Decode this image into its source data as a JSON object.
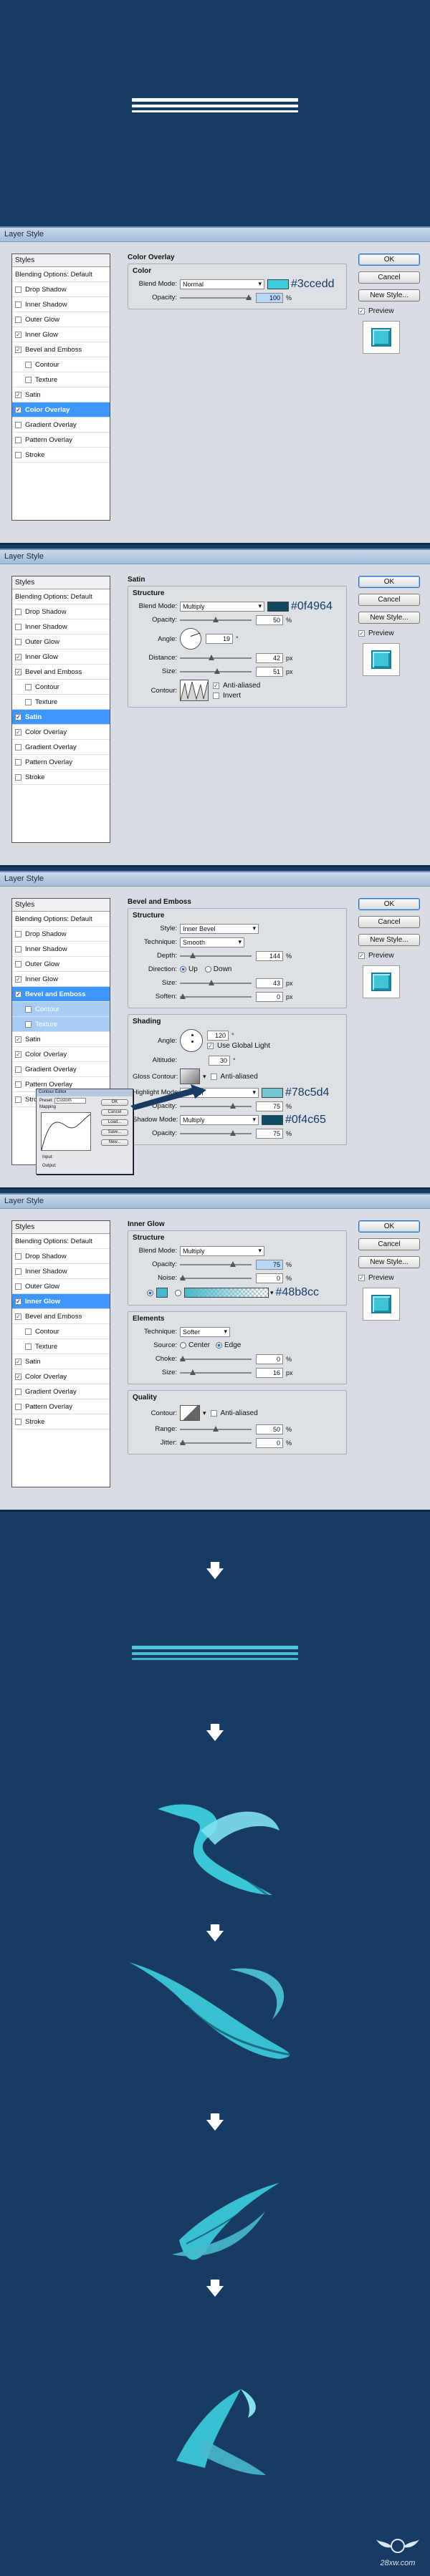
{
  "styles_list": [
    "Styles",
    "Blending Options: Default",
    "Drop Shadow",
    "Inner Shadow",
    "Outer Glow",
    "Inner Glow",
    "Bevel and Emboss",
    "Contour",
    "Texture",
    "Satin",
    "Color Overlay",
    "Gradient Overlay",
    "Pattern Overlay",
    "Stroke"
  ],
  "buttons": {
    "ok": "OK",
    "cancel": "Cancel",
    "new_style": "New Style...",
    "preview": "Preview"
  },
  "dialog_title": "Layer Style",
  "dialog1": {
    "section": "Color Overlay",
    "group": "Color",
    "blend_label": "Blend Mode:",
    "blend_value": "Normal",
    "opacity_label": "Opacity:",
    "opacity_value": "100",
    "unit": "%",
    "color_hex": "#3ccedd",
    "color": "#3ccedd"
  },
  "dialog2": {
    "section": "Satin",
    "group": "Structure",
    "blend_label": "Blend Mode:",
    "blend_value": "Multiply",
    "opacity_label": "Opacity:",
    "opacity_value": "50",
    "angle_label": "Angle:",
    "angle_value": "19",
    "distance_label": "Distance:",
    "distance_value": "42",
    "size_label": "Size:",
    "size_value": "51",
    "contour_label": "Contour:",
    "antialiased": "Anti-aliased",
    "invert": "Invert",
    "unit_pct": "%",
    "unit_px": "px",
    "unit_deg": "°",
    "color_hex": "#0f4964",
    "color": "#0f4964"
  },
  "dialog3": {
    "section": "Bevel and Emboss",
    "structure": "Structure",
    "style_label": "Style:",
    "style_value": "Inner Bevel",
    "technique_label": "Technique:",
    "technique_value": "Smooth",
    "depth_label": "Depth:",
    "depth_value": "144",
    "direction_label": "Direction:",
    "up": "Up",
    "down": "Down",
    "size_label": "Size:",
    "size_value": "43",
    "soften_label": "Soften:",
    "soften_value": "0",
    "shading": "Shading",
    "angle_label": "Angle:",
    "angle_value": "120",
    "global_light": "Use Global Light",
    "altitude_label": "Altitude:",
    "altitude_value": "30",
    "gloss_label": "Gloss Contour:",
    "antialiased": "Anti-aliased",
    "highlight_label": "Highlight Mode:",
    "highlight_value": "Screen",
    "hl_opacity_label": "Opacity:",
    "hl_opacity_value": "75",
    "shadow_label": "Shadow Mode:",
    "shadow_value": "Multiply",
    "sh_opacity_label": "Opacity:",
    "sh_opacity_value": "75",
    "unit_pct": "%",
    "unit_px": "px",
    "highlight_hex": "#78c5d4",
    "shadow_hex": "#0f4c65",
    "highlight_color": "#78c5d4",
    "shadow_color": "#0f4c65"
  },
  "contour_editor": {
    "title": "Contour Editor",
    "preset_label": "Preset:",
    "preset_value": "Custom",
    "mapping": "Mapping",
    "input_label": "Input:",
    "output_label": "Output:",
    "buttons": [
      "OK",
      "Cancel",
      "Load...",
      "Save...",
      "New..."
    ]
  },
  "dialog4": {
    "section": "Inner Glow",
    "structure": "Structure",
    "blend_label": "Blend Mode:",
    "blend_value": "Multiply",
    "opacity_label": "Opacity:",
    "opacity_value": "75",
    "noise_label": "Noise:",
    "noise_value": "0",
    "elements": "Elements",
    "technique_label": "Technique:",
    "technique_value": "Softer",
    "source_label": "Source:",
    "center": "Center",
    "edge": "Edge",
    "choke_label": "Choke:",
    "choke_value": "0",
    "size_label": "Size:",
    "size_value": "16",
    "quality": "Quality",
    "contour_label": "Contour:",
    "antialiased": "Anti-aliased",
    "range_label": "Range:",
    "range_value": "50",
    "jitter_label": "Jitter:",
    "jitter_value": "0",
    "unit_pct": "%",
    "unit_px": "px",
    "color_hex": "#48b8cc",
    "color": "#48b8cc"
  },
  "watermark": "28xw.com"
}
